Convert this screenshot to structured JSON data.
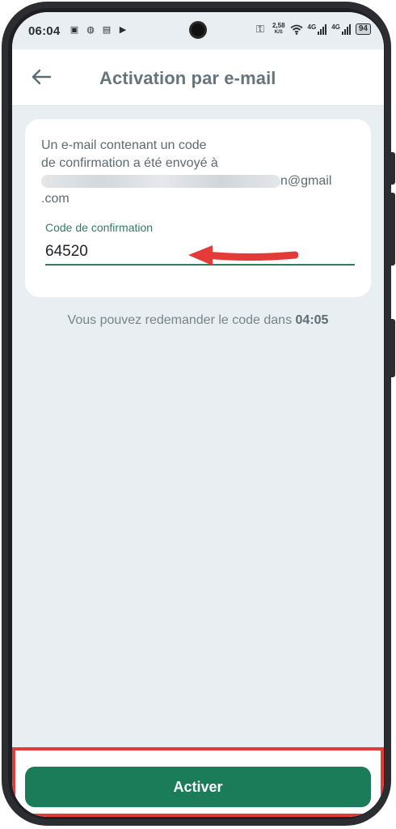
{
  "status_bar": {
    "time": "06:04",
    "net_speed_value": "2,58",
    "net_speed_unit": "K/S",
    "sim1_label": "4G",
    "sim2_label": "4G",
    "battery": "94"
  },
  "header": {
    "title": "Activation par e-mail"
  },
  "card": {
    "info_line1": "Un e-mail contenant un code",
    "info_line2": "de confirmation a été envoyé à",
    "email_suffix": "n@gmail",
    "email_suffix2": ".com",
    "code_label": "Code de confirmation",
    "code_value": "64520"
  },
  "resend": {
    "text": "Vous pouvez redemander le code dans ",
    "timer": "04:05"
  },
  "footer": {
    "activate_label": "Activer"
  },
  "colors": {
    "accent": "#1a7c58",
    "label_green": "#2f7d5f",
    "annotation_red": "#e43a38",
    "screen_bg": "#e8eef2"
  }
}
